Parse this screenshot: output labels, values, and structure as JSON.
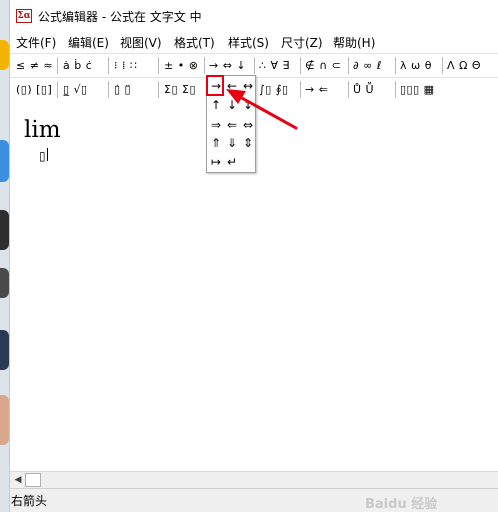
{
  "window": {
    "title": "公式编辑器 - 公式在 文字文 中",
    "icon_label": "Σα"
  },
  "menubar": {
    "items": [
      "文件(F)",
      "编辑(E)",
      "视图(V)",
      "格式(T)",
      "样式(S)",
      "尺寸(Z)",
      "帮助(H)"
    ]
  },
  "toolbar": {
    "row1": [
      "≤ ≠ ≈",
      "ȧ ḃ ċ",
      "⁝ ⁞ ∷",
      "± • ⊗",
      "→ ⇔ ↓",
      "∴ ∀ ∃",
      "∉ ∩ ⊂",
      "∂ ∞ ℓ",
      "λ ω θ",
      "Λ Ω Θ"
    ],
    "row2": [
      "(▯) [▯]",
      "▯̲ √▯",
      "▯̇ ▯̈",
      "Σ▯ Σ▯",
      "∫▯ ∮▯",
      "▯̅ ▯̲",
      "→ ⇐",
      "Ů Ṻ",
      "▯▯▯ ▦"
    ]
  },
  "arrow_palette": {
    "tooltip": "右箭头",
    "rows": [
      [
        "→",
        "←",
        "↔"
      ],
      [
        "↑",
        "↓",
        "↕"
      ],
      [
        "⇒",
        "⇐",
        "⇔"
      ],
      [
        "⇑",
        "⇓",
        "⇕"
      ],
      [
        "↦",
        "↵"
      ]
    ],
    "selected": "→"
  },
  "canvas": {
    "function": "lim",
    "subscript_slot": "▯"
  },
  "status": {
    "text": "右箭头"
  },
  "watermark": {
    "text": "Baidu 经验"
  },
  "colors": {
    "highlight": "#e60012",
    "annotation_arrow": "#e60012"
  }
}
